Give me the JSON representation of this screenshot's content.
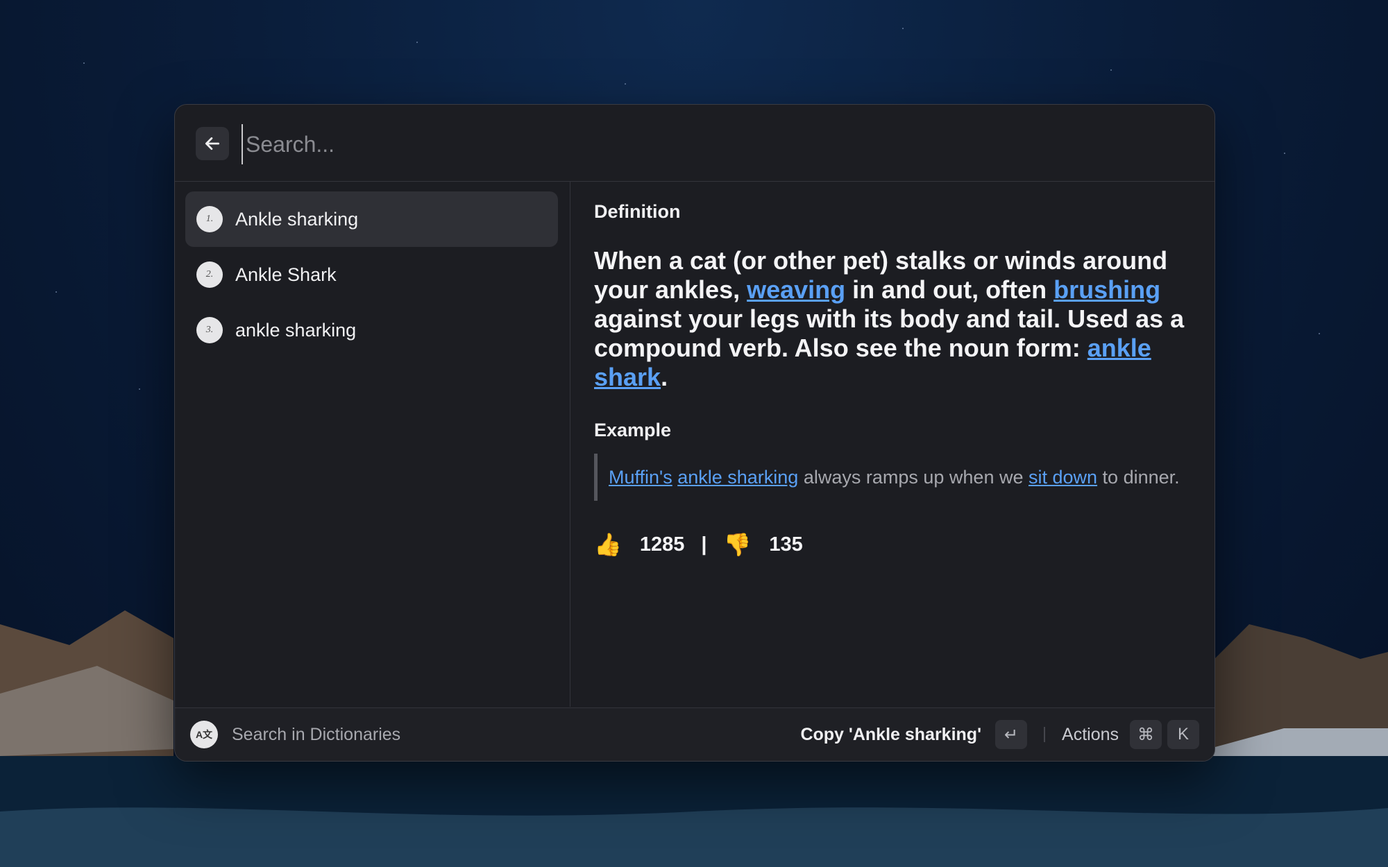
{
  "search": {
    "placeholder": "Search..."
  },
  "results": [
    {
      "number": "1.",
      "label": "Ankle sharking",
      "selected": true
    },
    {
      "number": "2.",
      "label": "Ankle Shark",
      "selected": false
    },
    {
      "number": "3.",
      "label": "ankle sharking",
      "selected": false
    }
  ],
  "detail": {
    "definition_label": "Definition",
    "definition_parts": [
      "When a cat (or other pet) stalks or winds around your ankles, ",
      "weaving",
      " in and out, often ",
      "brushing",
      " against your legs with its body and tail. Used as a compound verb. Also see the noun form: ",
      "ankle shark",
      "."
    ],
    "example_label": "Example",
    "example_parts": [
      "Muffin's",
      " ",
      "ankle sharking",
      " always ramps up when we ",
      "sit down",
      " to dinner."
    ],
    "thumbs_up_count": "1285",
    "separator": "|",
    "thumbs_down_count": "135"
  },
  "footer": {
    "dict_icon_text": "A文",
    "search_in": "Search in Dictionaries",
    "copy_label": "Copy 'Ankle sharking'",
    "enter_key": "↵",
    "actions_label": "Actions",
    "cmd_key": "⌘",
    "k_key": "K"
  },
  "icons": {
    "back": "arrow-left-icon",
    "thumbs_up": "👍",
    "thumbs_down": "👎"
  },
  "colors": {
    "link": "#5aa0f5",
    "panel": "#1c1d22"
  }
}
